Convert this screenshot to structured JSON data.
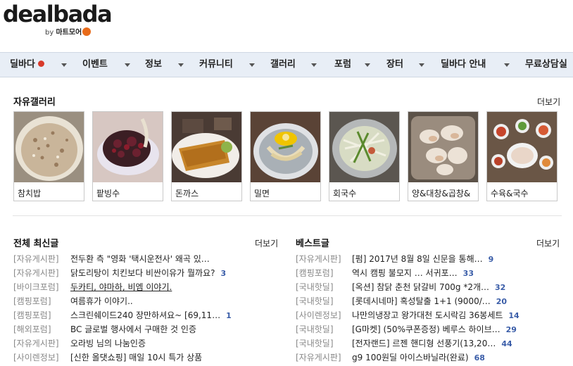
{
  "logo": {
    "main": "dealbada",
    "sub_by": "by",
    "sub_brand": "마트모어"
  },
  "nav": [
    {
      "label": "딜바다",
      "red_dot": true
    },
    {
      "label": "이벤트"
    },
    {
      "label": "정보"
    },
    {
      "label": "커뮤니티"
    },
    {
      "label": "갤러리"
    },
    {
      "label": "포럼"
    },
    {
      "label": "장터"
    },
    {
      "label": "딜바다 안내"
    },
    {
      "label": "무료상담실"
    }
  ],
  "gallery": {
    "title": "자유갤러리",
    "more": "더보기",
    "items": [
      {
        "caption": "참치밥",
        "icon": "tuna-rice-photo"
      },
      {
        "caption": "팥빙수",
        "icon": "patbingsu-photo"
      },
      {
        "caption": "돈까스",
        "icon": "donkatsu-photo"
      },
      {
        "caption": "밀면",
        "icon": "milmyeon-photo"
      },
      {
        "caption": "회국수",
        "icon": "hoeguksu-photo"
      },
      {
        "caption": "양&대창&곱창&",
        "icon": "grilled-tripe-photo"
      },
      {
        "caption": "수육&국수",
        "icon": "suyuk-photo"
      }
    ]
  },
  "latest": {
    "title": "전체 최신글",
    "more": "더보기",
    "rows": [
      {
        "cat": "[자유게시판]",
        "title": "전두환 측 \"영화 '택시운전사' 왜곡 있…",
        "count": ""
      },
      {
        "cat": "[자유게시판]",
        "title": "닭도리탕이 치킨보다 비싼이유가 뭘까요?",
        "count": "3"
      },
      {
        "cat": "[바이크포럼]",
        "title": "두카티, 야마하, 비엠 이야기.",
        "count": "",
        "underline": true
      },
      {
        "cat": "[캠핑포럼]",
        "title": "여름휴가 이야기..",
        "count": ""
      },
      {
        "cat": "[캠핑포럼]",
        "title": "스크린쉐이드240 장만하셔요~ [69,11…",
        "count": "1"
      },
      {
        "cat": "[해외포럼]",
        "title": "BC 글로벌 행사에서 구매한 것 인증",
        "count": ""
      },
      {
        "cat": "[자유게시판]",
        "title": "오라빙 님의 나눔인증",
        "count": ""
      },
      {
        "cat": "[사이렌정보]",
        "title": "[신한 올댓쇼핑] 매일 10시 특가 상품",
        "count": ""
      }
    ]
  },
  "best": {
    "title": "베스트글",
    "more": "더보기",
    "rows": [
      {
        "cat": "[자유게시판]",
        "title": "[펌] 2017년 8월 8일 신문을 통해…",
        "count": "9"
      },
      {
        "cat": "[캠핑포럼]",
        "title": "역시 캠핑 불모지 … 서귀포…",
        "count": "33"
      },
      {
        "cat": "[국내핫딜]",
        "title": "[옥션] 참닭 춘천 닭갈비 700g *2개…",
        "count": "32"
      },
      {
        "cat": "[국내핫딜]",
        "title": "[롯데시네마] 혹성탈출 1+1 (9000/…",
        "count": "20"
      },
      {
        "cat": "[사이렌정보]",
        "title": "나만의냉장고 왕가대천 도시락김 36봉세트",
        "count": "14"
      },
      {
        "cat": "[국내핫딜]",
        "title": "[G마켓] (50%쿠폰증정) 베루스 하이브…",
        "count": "29"
      },
      {
        "cat": "[국내핫딜]",
        "title": "[전자랜드] 르젠 핸디형 선풍기(13,20…",
        "count": "44"
      },
      {
        "cat": "[자유게시판]",
        "title": "g9 100원딜 아이스바닐라(완료)",
        "count": "68"
      }
    ]
  }
}
